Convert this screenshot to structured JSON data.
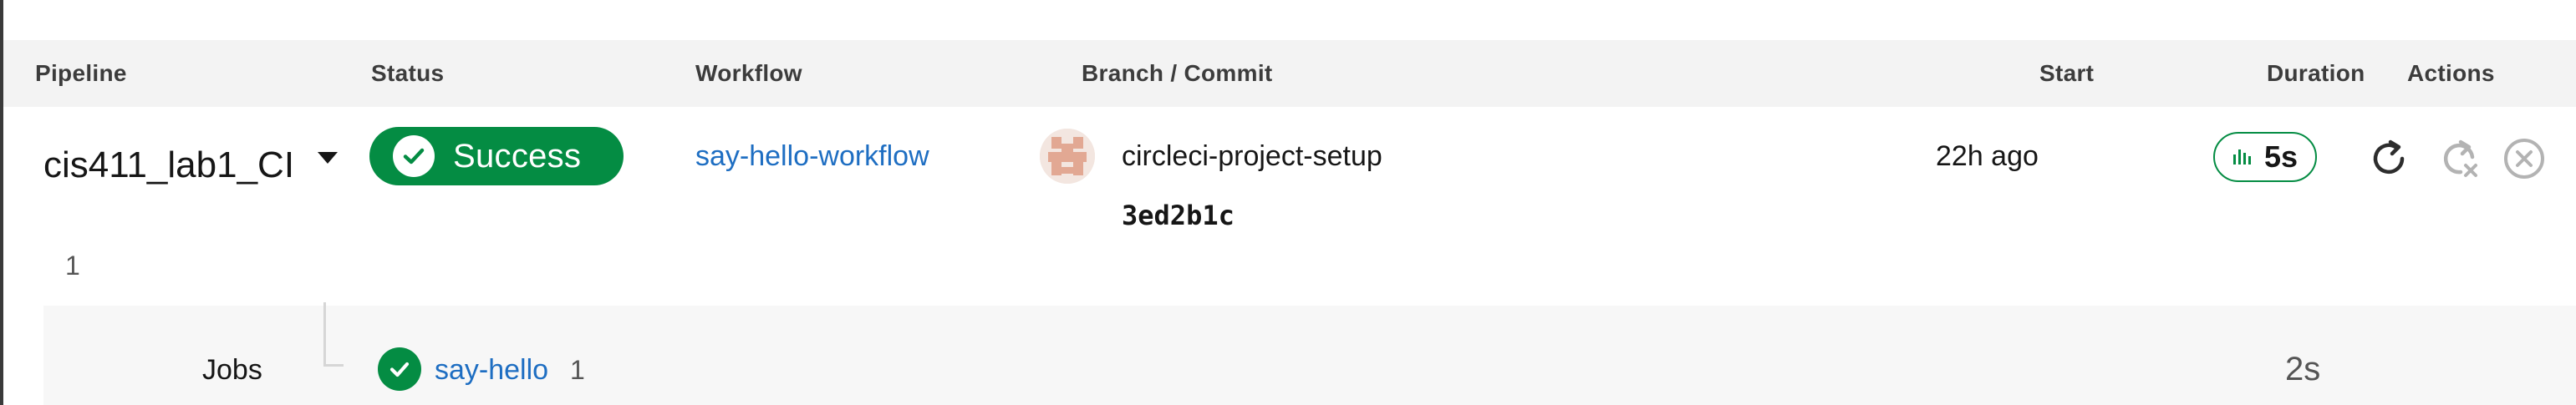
{
  "colors": {
    "success": "#048c43",
    "link": "#1e6ec2",
    "header_bg": "#f3f3f3"
  },
  "table": {
    "headers": {
      "pipeline": "Pipeline",
      "status": "Status",
      "workflow": "Workflow",
      "branch_commit": "Branch / Commit",
      "start": "Start",
      "duration": "Duration",
      "actions": "Actions"
    },
    "row": {
      "pipeline_name": "cis411_lab1_CI",
      "pipeline_number": "1",
      "status": "Success",
      "status_icon": "check-circle-icon",
      "workflow": "say-hello-workflow",
      "branch": "circleci-project-setup",
      "commit": "3ed2b1c",
      "start": "22h ago",
      "duration": "5s",
      "duration_icon": "bar-chart-icon",
      "actions": [
        "rerun-icon",
        "rerun-failed-icon",
        "cancel-icon"
      ]
    },
    "jobs": {
      "label": "Jobs",
      "items": [
        {
          "name": "say-hello",
          "number": "1",
          "duration": "2s",
          "status_icon": "check-circle-icon"
        }
      ]
    }
  }
}
